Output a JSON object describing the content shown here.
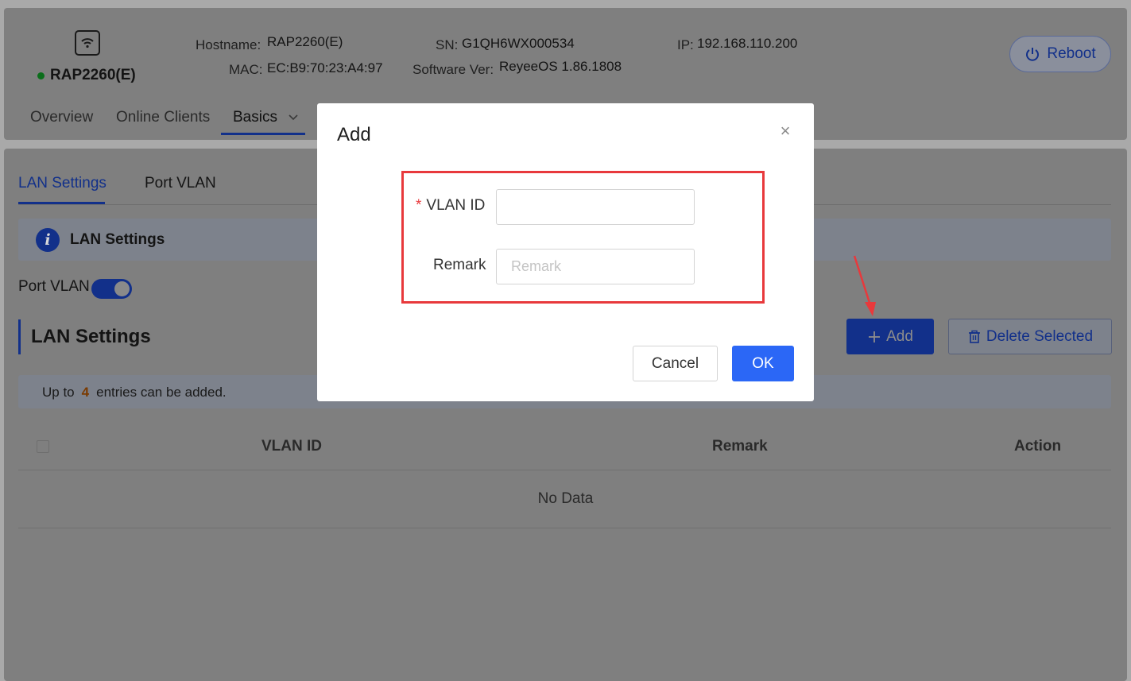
{
  "device": {
    "name": "RAP2260(E)",
    "status_color": "#1aa83a",
    "icon": "wifi-router-icon",
    "labels": {
      "hostname": "Hostname:",
      "sn": "SN:",
      "ip": "IP:",
      "mac": "MAC:",
      "software": "Software Ver:"
    },
    "values": {
      "hostname": "RAP2260(E)",
      "sn": "G1QH6WX000534",
      "ip": "192.168.110.200",
      "mac": "EC:B9:70:23:A4:97",
      "software": "ReyeeOS 1.86.1808"
    },
    "reboot_label": "Reboot"
  },
  "nav": {
    "tabs": [
      {
        "label": "Overview"
      },
      {
        "label": "Online Clients"
      },
      {
        "label": "Basics",
        "active": true
      }
    ]
  },
  "subnav": {
    "tabs": [
      {
        "label": "LAN Settings",
        "active": true
      },
      {
        "label": "Port VLAN"
      }
    ]
  },
  "info_banner": {
    "icon": "info-icon",
    "icon_glyph": "i",
    "title": "LAN Settings"
  },
  "port_vlan": {
    "label": "Port VLAN",
    "enabled": true
  },
  "section": {
    "title": "LAN Settings",
    "add_label": "Add",
    "delete_label": "Delete Selected"
  },
  "limit": {
    "prefix": "Up to",
    "count": "4",
    "suffix": "entries can be added."
  },
  "table": {
    "columns": [
      "VLAN ID",
      "Remark",
      "Action"
    ],
    "empty_text": "No Data"
  },
  "modal": {
    "title": "Add",
    "close_glyph": "×",
    "fields": [
      {
        "label": "VLAN ID",
        "required": true,
        "required_mark": "*",
        "value": "",
        "placeholder": ""
      },
      {
        "label": "Remark",
        "required": false,
        "value": "",
        "placeholder": "Remark"
      }
    ],
    "cancel_label": "Cancel",
    "ok_label": "OK"
  },
  "colors": {
    "accent": "#2b67f6",
    "highlight": "#e8393c",
    "overlay": "#808080"
  }
}
